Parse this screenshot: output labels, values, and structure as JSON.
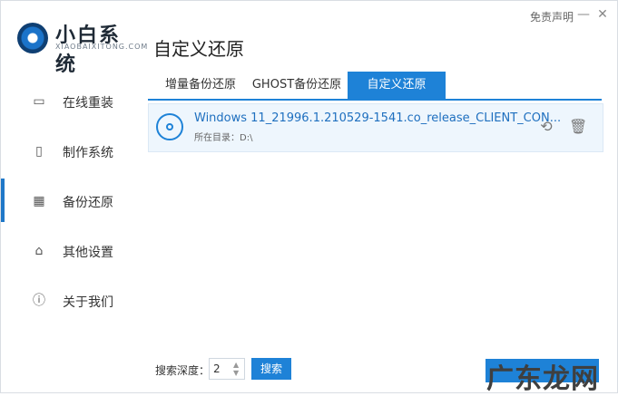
{
  "window": {
    "disclaimer_label": "免责声明",
    "minimize_icon": "minus",
    "close_icon": "close"
  },
  "brand": {
    "title": "小白系统",
    "subtitle": "XIAOBAIXITONG.COM"
  },
  "sidebar": {
    "items": [
      {
        "label": "在线重装",
        "icon": "monitor-icon"
      },
      {
        "label": "制作系统",
        "icon": "usb-icon"
      },
      {
        "label": "备份还原",
        "icon": "grid-icon",
        "active": true
      },
      {
        "label": "其他设置",
        "icon": "briefcase-icon"
      },
      {
        "label": "关于我们",
        "icon": "info-icon"
      }
    ]
  },
  "main": {
    "title": "自定义还原",
    "tabs": [
      {
        "label": "增量备份还原"
      },
      {
        "label": "GHOST备份还原"
      },
      {
        "label": "自定义还原",
        "active": true
      }
    ],
    "list": [
      {
        "name": "Windows 11_21996.1.210529-1541.co_release_CLIENT_CON...",
        "path": "所在目录：D:\\"
      }
    ],
    "footer": {
      "depth_label": "搜索深度：",
      "depth_value": "2",
      "search_label": "搜索",
      "watermark": "广东龙网"
    }
  },
  "colors": {
    "accent": "#1e82d7",
    "selected_row_bg": "#eef6fd"
  }
}
